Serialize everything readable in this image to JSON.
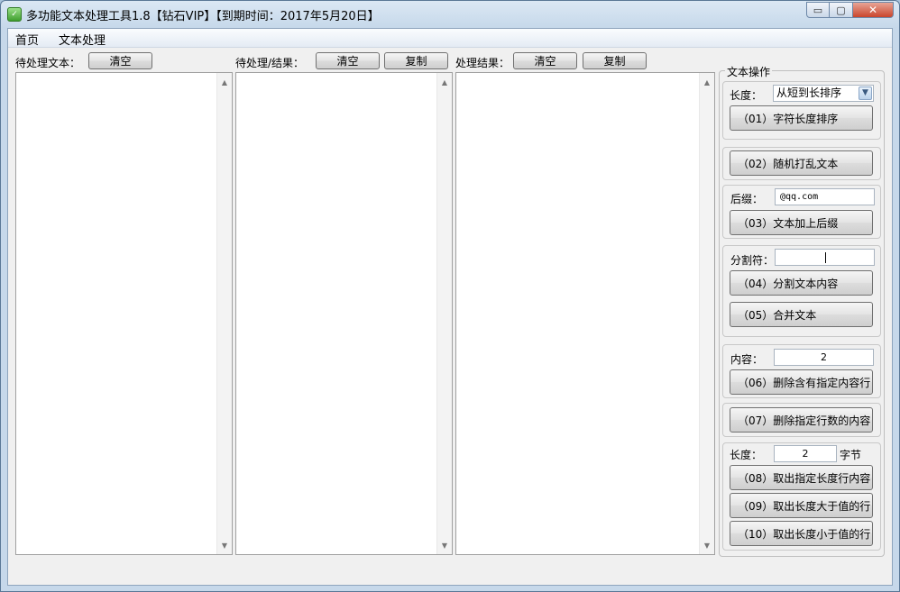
{
  "window": {
    "title": "多功能文本处理工具1.8【钻石VIP】【到期时间：2017年5月20日】",
    "icon": "app-logo-icon",
    "controls": {
      "minimize": "▭",
      "maximize": "▢",
      "close": "✕"
    }
  },
  "menu": {
    "items": [
      "首页",
      "文本处理"
    ]
  },
  "panels": {
    "input": {
      "label": "待处理文本：",
      "clear": "清空"
    },
    "middle": {
      "label": "待处理/结果：",
      "clear": "清空",
      "copy": "复制"
    },
    "result": {
      "label": "处理结果：",
      "clear": "清空",
      "copy": "复制"
    }
  },
  "ops": {
    "group_title": "文本操作",
    "sort": {
      "label": "长度：",
      "select_value": "从短到长排序",
      "button": "（01）字符长度排序"
    },
    "shuffle": {
      "button": "（02）随机打乱文本"
    },
    "suffix": {
      "label": "后缀：",
      "value": "@qq.com",
      "button": "（03）文本加上后缀"
    },
    "split": {
      "label": "分割符：",
      "value": "",
      "button_split": "（04）分割文本内容",
      "button_merge": "（05）合并文本"
    },
    "remove_content": {
      "label": "内容：",
      "value": "2",
      "button": "（06）删除含有指定内容行"
    },
    "remove_lines": {
      "button": "（07）删除指定行数的内容"
    },
    "length": {
      "label": "长度：",
      "value": "2",
      "unit": "字节",
      "button_exact": "（08）取出指定长度行内容",
      "button_greater": "（09）取出长度大于值的行",
      "button_less": "（10）取出长度小于值的行"
    }
  },
  "colors": {
    "accent": "#3f9f2e",
    "frame": "#c6d8ea",
    "client": "#f0f0f0"
  }
}
